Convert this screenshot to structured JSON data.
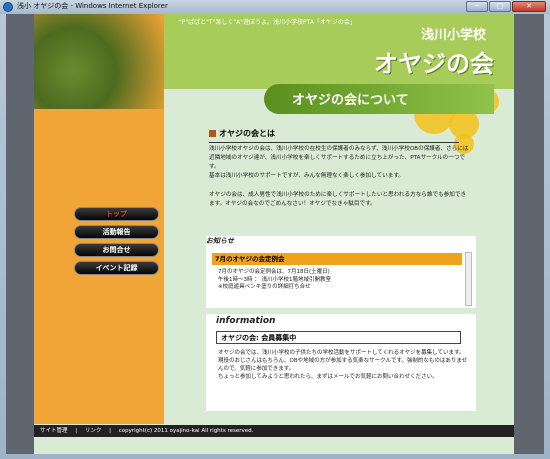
{
  "window": {
    "title": "浅小 オヤジの会 - Windows Internet Explorer",
    "min": "─",
    "max": "□",
    "close": "✕"
  },
  "header": {
    "tagline": "\"P\"ぱぱと\"T\"楽しく\"A\"遊ぼうよ。浅川小学校PTA「オヤジの会」",
    "school": "浅川小学校",
    "club": "オヤジの会",
    "about": "オヤジの会について"
  },
  "section1": {
    "title": "オヤジの会とは",
    "p1": "浅川小学校オヤジの会は、浅川小学校の在校生の保護者のみならず、浅川小学校OBの保護者、さらには近隣地域のオヤジ達が、浅川小学校を楽しくサポートするために立ち上がった、PTAサークルの一つです。",
    "p2": "基本は浅川小学校のサポートですが、みんな無理なく楽しく参加しています。",
    "p3": "オヤジの会は、成人男性で浅川小学校のために楽しくサポートしたいと思われる方なら誰でも参加できます。オヤジの会なのでごめんなさい！オヤジでなきゃ駄目です。"
  },
  "nav": {
    "items": [
      "トップ",
      "活動報告",
      "お問合せ",
      "イベント記録"
    ]
  },
  "news": {
    "heading": "お知らせ",
    "bar": "7月のオヤジの会定例会",
    "line1": "7月のオヤジの会定例会は、7月18日(土曜日)",
    "line2": "午後1時〜3時 ： 浅川小学校1階地域引開教室",
    "line3": "※校庭遊具ペンキ塗りの詳細打ち合せ"
  },
  "info": {
    "heading": "information",
    "box": "オヤジの会: 会員募集中",
    "line1": "オヤジの会では、浅川小学校の子供たちの学校活動をサポートしてくれるオヤジを募集しています。",
    "line2": "現役のおじさんはもちろん、OBや地域の方が参加する気楽なサークルです。強制的なものはありませんので、気軽に参加できます。",
    "line3": "ちょっと参加してみようと思われたら、まずはメールでお気軽にお問い合わせください。"
  },
  "footer": {
    "admin": "サイト管理",
    "sep": "|",
    "link": "リンク",
    "copyright": "copyright(c) 2011 oyajino-kai All rights reserved."
  }
}
